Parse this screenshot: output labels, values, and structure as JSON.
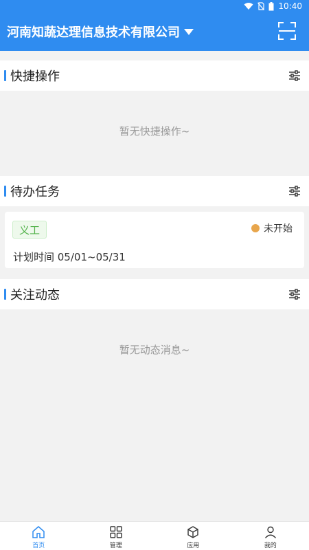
{
  "status_bar": {
    "time": "10:40"
  },
  "header": {
    "company": "河南知蔬达理信息技术有限公司"
  },
  "sections": {
    "quick": {
      "title": "快捷操作",
      "empty": "暂无快捷操作~"
    },
    "todo": {
      "title": "待办任务"
    },
    "follow": {
      "title": "关注动态",
      "empty": "暂无动态消息~"
    }
  },
  "task": {
    "tag": "义工",
    "status": "未开始",
    "time": "计划时间 05/01~05/31",
    "status_color": "#e8a64c"
  },
  "tabbar": {
    "items": [
      {
        "label": "首页",
        "icon": "home-icon",
        "active": true
      },
      {
        "label": "管理",
        "icon": "grid-icon",
        "active": false
      },
      {
        "label": "应用",
        "icon": "cube-icon",
        "active": false
      },
      {
        "label": "我的",
        "icon": "user-icon",
        "active": false
      }
    ]
  },
  "colors": {
    "primary": "#2f8cf0",
    "tag_green": "#52b24a"
  }
}
